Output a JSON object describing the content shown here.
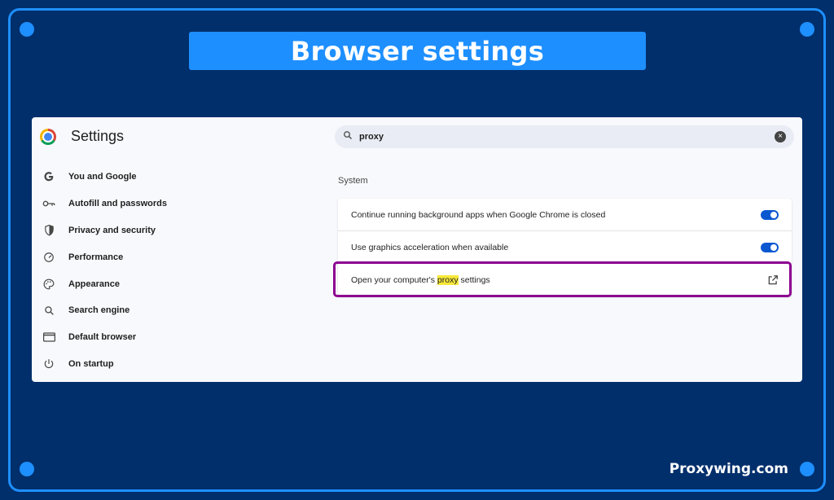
{
  "banner": {
    "title": "Browser settings"
  },
  "brand": {
    "text": "Proxywing.com"
  },
  "settings": {
    "app_title": "Settings",
    "nav_items": [
      {
        "label": "You and Google",
        "icon": "google-g-icon"
      },
      {
        "label": "Autofill and passwords",
        "icon": "key-icon"
      },
      {
        "label": "Privacy and security",
        "icon": "shield-icon"
      },
      {
        "label": "Performance",
        "icon": "speedometer-icon"
      },
      {
        "label": "Appearance",
        "icon": "palette-icon"
      },
      {
        "label": "Search engine",
        "icon": "search-icon"
      },
      {
        "label": "Default browser",
        "icon": "browser-window-icon"
      },
      {
        "label": "On startup",
        "icon": "power-icon"
      }
    ],
    "search": {
      "value": "proxy"
    },
    "section_title": "System",
    "rows": [
      {
        "label": "Continue running background apps when Google Chrome is closed",
        "toggle": true
      },
      {
        "label": "Use graphics acceleration when available",
        "toggle": true
      },
      {
        "label_before": "Open your computer's ",
        "label_highlight": "proxy",
        "label_after": " settings",
        "icon": "open-external-icon"
      }
    ]
  },
  "colors": {
    "background": "#002f6c",
    "accent": "#1e8fff",
    "highlight_border": "#8d0091",
    "search_highlight": "#f7e93a",
    "toggle_on": "#0b57d0"
  }
}
